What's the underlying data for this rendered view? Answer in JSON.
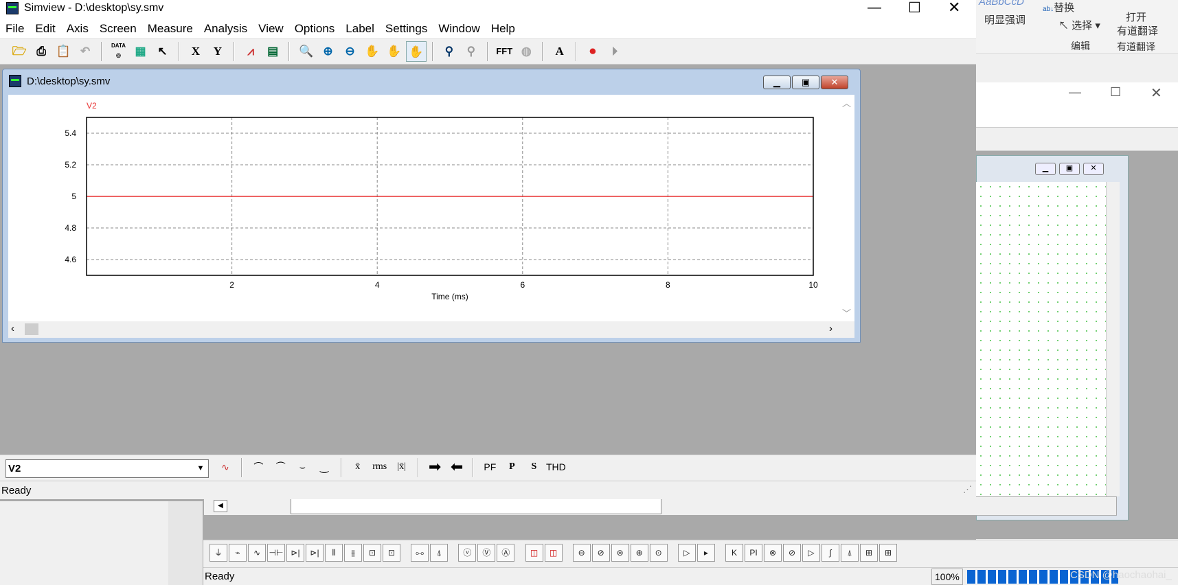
{
  "simview": {
    "title": "Simview - D:\\desktop\\sy.smv",
    "menu": [
      "File",
      "Edit",
      "Axis",
      "Screen",
      "Measure",
      "Analysis",
      "View",
      "Options",
      "Label",
      "Settings",
      "Window",
      "Help"
    ],
    "toolbar": {
      "data_label": "DATA",
      "x_label": "X",
      "y_label": "Y",
      "fft_label": "FFT",
      "text_label": "A"
    },
    "child": {
      "title": "D:\\desktop\\sy.smv",
      "minimize": "▁",
      "restore": "▣",
      "close": "✕"
    },
    "bottom_toolbar": {
      "selected_variable": "V2",
      "rms_label": "rms",
      "mean_label": "x̄",
      "absmean_label": "|x̄|",
      "pf_label": "PF",
      "p_label": "P",
      "s_label": "S",
      "thd_label": "THD"
    },
    "status": "Ready"
  },
  "chart_data": {
    "type": "line",
    "series": [
      {
        "name": "V2",
        "x": [
          0,
          10
        ],
        "y": [
          5,
          5
        ],
        "color": "#e83030"
      }
    ],
    "xlabel": "Time (ms)",
    "ylabel": "",
    "xlim": [
      0,
      10
    ],
    "ylim": [
      4.5,
      5.5
    ],
    "xticks": [
      "2",
      "4",
      "6",
      "8",
      "10"
    ],
    "xtick_values": [
      2,
      4,
      6,
      8,
      10
    ],
    "yticks": [
      "5.4",
      "5.2",
      "5",
      "4.8",
      "4.6"
    ],
    "ytick_values": [
      5.4,
      5.2,
      5,
      4.8,
      4.6
    ],
    "grid": true
  },
  "background_app": {
    "ribbon": {
      "style_sample": "AaBbCcD",
      "emphasis": "明显强调",
      "replace": "替换",
      "select": "选择",
      "edit_group": "编辑",
      "open_translate_1": "打开",
      "open_translate_2": "有道翻译",
      "translate_group": "有道翻译"
    },
    "status": "Ready",
    "zoom": "100%",
    "watermark": "CSDN @haochaohai_"
  },
  "colors": {
    "trace": "#e83030",
    "accent": "#0a64d2"
  }
}
